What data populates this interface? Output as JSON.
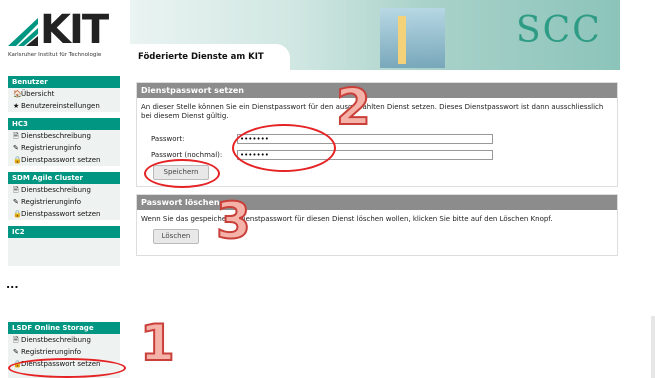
{
  "header": {
    "logo_text": "KIT",
    "logo_subtitle": "Karlsruher Institut für Technologie",
    "banner_title": "Föderierte Dienste am KIT",
    "banner_brand": "SCC"
  },
  "sidebar": {
    "sections": [
      {
        "title": "Benutzer",
        "items": [
          {
            "icon": "home-icon",
            "glyph": "🏠",
            "label": "Übersicht"
          },
          {
            "icon": "star-icon",
            "glyph": "★",
            "label": "Benutzereinstellungen"
          }
        ]
      },
      {
        "title": "HC3",
        "items": [
          {
            "icon": "doc-icon",
            "glyph": "🗎",
            "label": "Dienstbeschreibung"
          },
          {
            "icon": "pen-icon",
            "glyph": "✎",
            "label": "Registrierunginfo"
          },
          {
            "icon": "lock-icon",
            "glyph": "🔒",
            "label": "Dienstpasswort setzen"
          }
        ]
      },
      {
        "title": "SDM Agile Cluster",
        "items": [
          {
            "icon": "doc-icon",
            "glyph": "🗎",
            "label": "Dienstbeschreibung"
          },
          {
            "icon": "pen-icon",
            "glyph": "✎",
            "label": "Registrierunginfo"
          },
          {
            "icon": "lock-icon",
            "glyph": "🔒",
            "label": "Dienstpasswort setzen"
          }
        ]
      },
      {
        "title": "IC2",
        "items": []
      }
    ]
  },
  "set_password": {
    "heading": "Dienstpasswort setzen",
    "description": "An dieser Stelle können Sie ein Dienstpasswort für den ausgewählten Dienst setzen. Dieses Dienstpasswort ist dann ausschliesslich bei diesem Dienst gültig.",
    "password_label": "Passwort:",
    "password_value": "•••••••",
    "password_confirm_label": "Passwort (nochmal):",
    "password_confirm_value": "•••••••",
    "save_button": "Speichern"
  },
  "delete_password": {
    "heading": "Passwort löschen",
    "description": "Wenn Sie das gespeicherte Dienstpasswort für diesen Dienst löschen wollen, klicken Sie bitte auf den Löschen Knopf.",
    "delete_button": "Löschen"
  },
  "separator": "...",
  "lower_sidebar": {
    "title": "LSDF Online Storage",
    "items": [
      {
        "icon": "doc-icon",
        "glyph": "🗎",
        "label": "Dienstbeschreibung"
      },
      {
        "icon": "pen-icon",
        "glyph": "✎",
        "label": "Registrierunginfo"
      },
      {
        "icon": "lock-icon",
        "glyph": "🔒",
        "label": "Dienstpasswort setzen"
      }
    ]
  },
  "annotations": {
    "step1": "1",
    "step2": "2",
    "step3": "3"
  },
  "colors": {
    "accent": "#009682",
    "annotation_red": "#e52325",
    "box_header": "#8c8c8c"
  }
}
